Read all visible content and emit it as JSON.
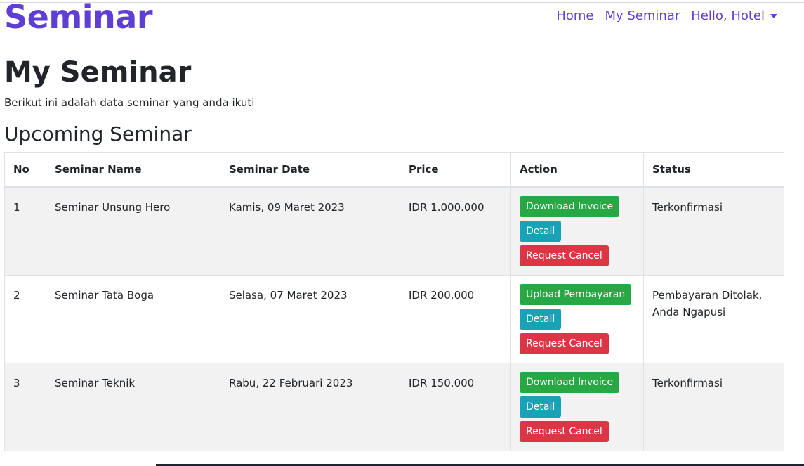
{
  "navbar": {
    "brand": "Seminar",
    "links": [
      "Home",
      "My Seminar",
      "Hello, Hotel"
    ]
  },
  "page": {
    "title": "My Seminar",
    "subtitle": "Berikut ini adalah data seminar yang anda ikuti",
    "section_title": "Upcoming Seminar"
  },
  "table": {
    "headers": [
      "No",
      "Seminar Name",
      "Seminar Date",
      "Price",
      "Action",
      "Status"
    ],
    "rows": [
      {
        "no": "1",
        "name": "Seminar Unsung Hero",
        "date": "Kamis, 09 Maret 2023",
        "price": "IDR 1.000.000",
        "actions": [
          "Download Invoice",
          "Detail",
          "Request Cancel"
        ],
        "status": "Terkonfirmasi"
      },
      {
        "no": "2",
        "name": "Seminar Tata Boga",
        "date": "Selasa, 07 Maret 2023",
        "price": "IDR 200.000",
        "actions": [
          "Upload Pembayaran",
          "Detail",
          "Request Cancel"
        ],
        "status": "Pembayaran Ditolak, Anda Ngapusi"
      },
      {
        "no": "3",
        "name": "Seminar Teknik",
        "date": "Rabu, 22 Februari 2023",
        "price": "IDR 150.000",
        "actions": [
          "Download Invoice",
          "Detail",
          "Request Cancel"
        ],
        "status": "Terkonfirmasi"
      }
    ]
  },
  "colors": {
    "brand": "#5f3fd3",
    "success": "#28a745",
    "info": "#17a2b8",
    "danger": "#dc3545"
  },
  "icons": {
    "user_dropdown": "chevron-down-icon"
  }
}
